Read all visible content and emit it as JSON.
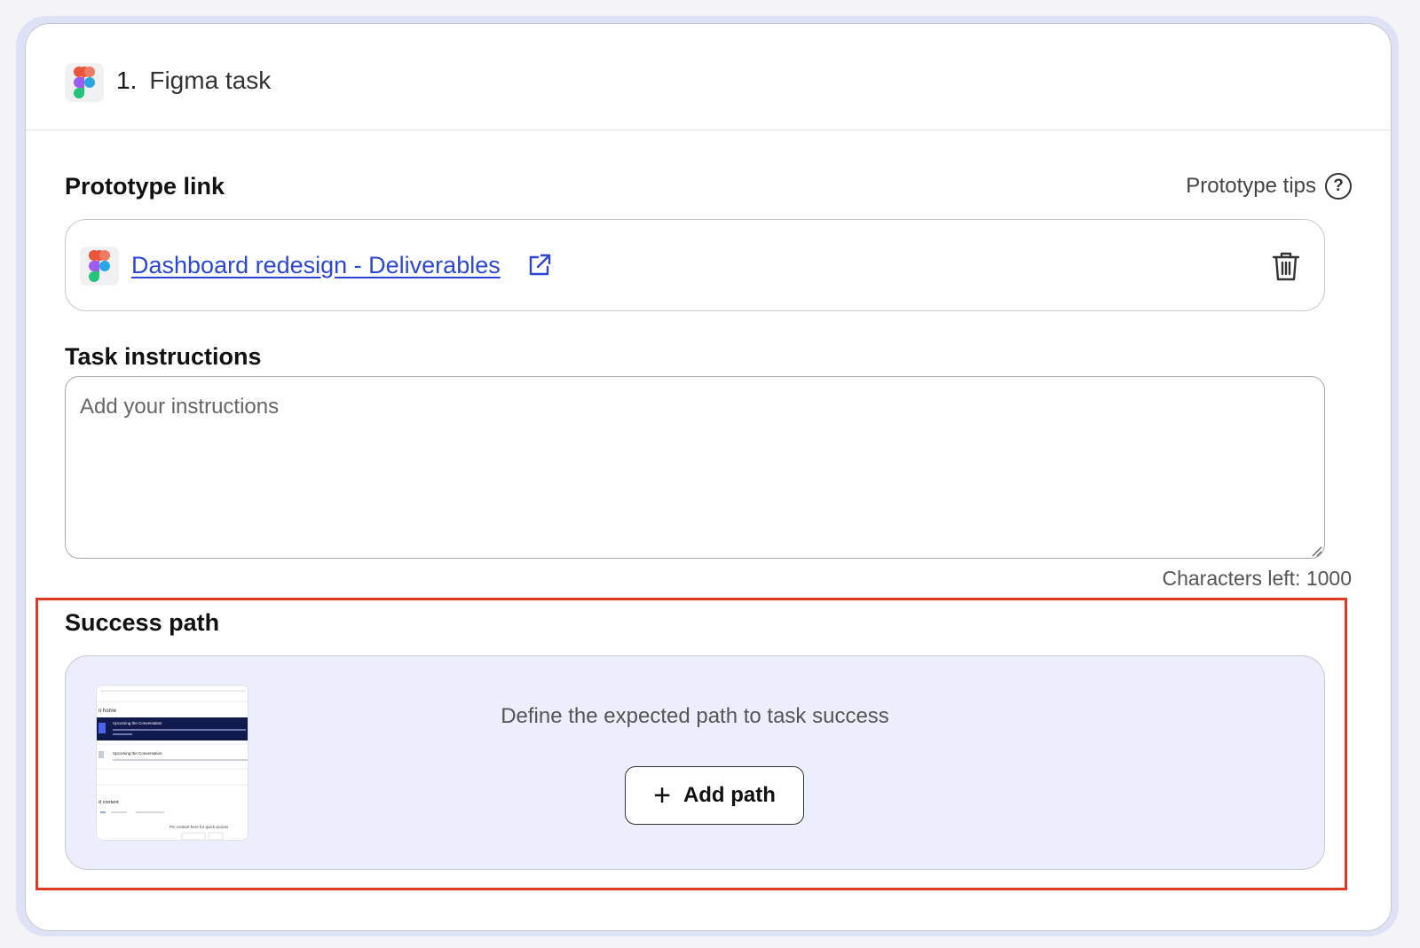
{
  "task": {
    "number": "1.",
    "title": "Figma task"
  },
  "prototype": {
    "label": "Prototype link",
    "tips_label": "Prototype tips",
    "link_text": "Dashboard redesign - Deliverables"
  },
  "instructions": {
    "label": "Task instructions",
    "placeholder": "Add your instructions",
    "chars_left": "Characters left: 1000"
  },
  "success_path": {
    "label": "Success path",
    "description": "Define the expected path to task success",
    "add_button": "Add path",
    "thumbnail": {
      "heading": "n home",
      "item1_title": "Upcoming the Conversation",
      "item2_title": "Upcoming the Conversation",
      "section": "d content",
      "pin_text": "Pin content here for quick access"
    }
  },
  "colors": {
    "link": "#2c46d6",
    "highlight": "#e03a24",
    "success_bg": "#eceefb",
    "outer_ring": "#dfe2f7"
  },
  "icons": [
    "figma-logo-icon",
    "external-link-icon",
    "trash-icon",
    "help-icon",
    "plus-icon",
    "resize-grip-icon"
  ]
}
